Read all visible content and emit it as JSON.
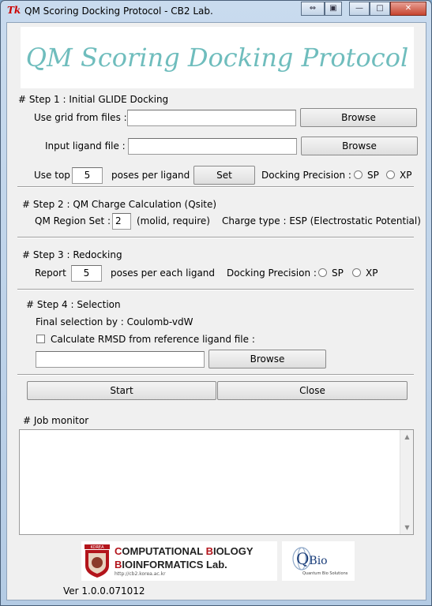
{
  "window": {
    "icon_text": "Tk",
    "title": "QM Scoring Docking Protocol - CB2 Lab.",
    "controls": {
      "restore": "⇔",
      "minimize": "—",
      "maximize": "□",
      "close": "✕"
    }
  },
  "banner": {
    "title": "QM Scoring Docking Protocol"
  },
  "step1": {
    "heading": "# Step 1 : Initial GLIDE Docking",
    "grid_label": "Use grid from files :",
    "grid_value": "",
    "grid_browse": "Browse",
    "ligand_label": "Input ligand file :",
    "ligand_value": "",
    "ligand_browse": "Browse",
    "use_top_label": "Use top",
    "use_top_value": "5",
    "poses_label": "poses per ligand",
    "set_button": "Set",
    "precision_label": "Docking Precision :",
    "sp_label": "SP",
    "xp_label": "XP"
  },
  "step2": {
    "heading": "# Step 2 : QM Charge Calculation (Qsite)",
    "region_label": "QM Region Set  :",
    "region_value": "2",
    "region_hint": "(molid, require)",
    "charge_type": "Charge type : ESP (Electrostatic Potential)"
  },
  "step3": {
    "heading": "# Step 3 : Redocking",
    "report_label": "Report",
    "report_value": "5",
    "poses_label": "poses per each ligand",
    "precision_label": "Docking Precision :",
    "sp_label": "SP",
    "xp_label": "XP"
  },
  "step4": {
    "heading": "# Step 4 : Selection",
    "final_selection": "Final selection by : Coulomb-vdW",
    "rmsd_label": "Calculate RMSD from reference ligand file :",
    "rmsd_checked": false,
    "rmsd_value": "",
    "browse": "Browse"
  },
  "actions": {
    "start": "Start",
    "close": "Close"
  },
  "monitor": {
    "label": "# Job monitor",
    "content": ""
  },
  "logos": {
    "korea_text": "KOREA",
    "cb_line1_a": "C",
    "cb_line1_b": "OMPUTATIONAL ",
    "cb_line1_c": "B",
    "cb_line1_d": "IOLOGY",
    "cb_line2_a": "B",
    "cb_line2_b": "IOINFORMATICS Lab.",
    "cb_url": "http://cb2.korea.ac.kr",
    "qbio_q": "Q",
    "qbio_rest": "Bio",
    "qbio_sub": "Quantum Bio Solutions"
  },
  "version": "Ver 1.0.0.071012",
  "colors": {
    "banner_text": "#6fbdbd",
    "brand_red": "#b3141b",
    "qbio_blue": "#1b3e7a"
  }
}
